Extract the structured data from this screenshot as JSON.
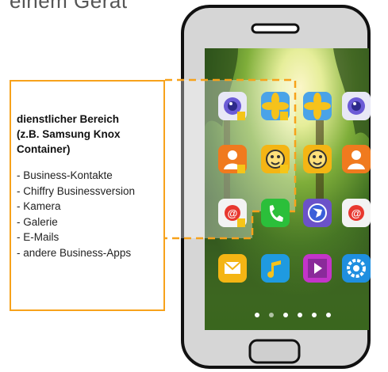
{
  "heading_fragment": "einem Gerät",
  "callout": {
    "title_line1": "dienstlicher Bereich",
    "title_line2": "(z.B. Samsung Knox",
    "title_line3": "Container)",
    "items": [
      "- Business-Kontakte",
      "- Chiffry Businessversion",
      "- Kamera",
      "- Galerie",
      "- E-Mails",
      "- andere Business-Apps"
    ]
  },
  "colors": {
    "accent_orange": "#f7a21b",
    "phone_body": "#d6d6d6",
    "phone_outline": "#111111"
  },
  "apps": [
    [
      "camera-icon",
      "gallery-icon",
      "gallery-icon",
      "camera-icon"
    ],
    [
      "contacts-icon",
      "chiffry-icon",
      "chiffry-icon",
      "contacts-icon"
    ],
    [
      "email-icon",
      "phone-icon",
      "internet-icon",
      "email-icon"
    ],
    [
      "messages-icon",
      "music-icon",
      "video-icon",
      "settings-icon"
    ]
  ],
  "secured_apps": [
    "camera-icon-secure",
    "gallery-icon-secure",
    "contacts-icon-secure",
    "chiffry-icon-secure",
    "email-icon-secure"
  ],
  "page_dots": 6
}
